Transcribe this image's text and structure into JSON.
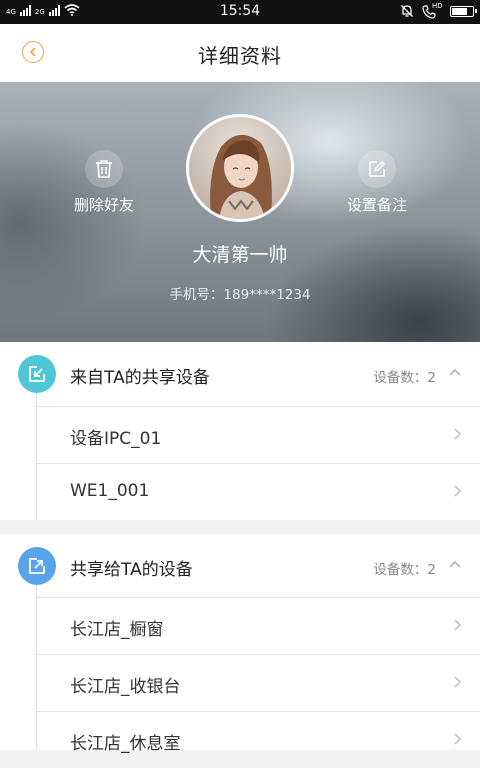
{
  "status_bar": {
    "net1": "4G",
    "net2": "2G",
    "time": "15:54",
    "hd": "HD",
    "battery_level": 0.85
  },
  "nav": {
    "back_icon": "chevron-left-icon",
    "title": "详细资料"
  },
  "profile": {
    "delete_label": "删除好友",
    "remark_label": "设置备注",
    "name": "大清第一帅",
    "phone": "手机号：189****1234"
  },
  "shared_from": {
    "title": "来自TA的共享设备",
    "count": "设备数：2",
    "items": [
      "设备IPC_01",
      "WE1_001"
    ]
  },
  "shared_to": {
    "title": "共享给TA的设备",
    "count": "设备数：2",
    "items": [
      "长江店_橱窗",
      "长江店_收银台",
      "长江店_休息室"
    ]
  },
  "colors": {
    "accent": "#f0a24a",
    "teal": "#4fc6d5",
    "blue": "#5aa3ea"
  }
}
